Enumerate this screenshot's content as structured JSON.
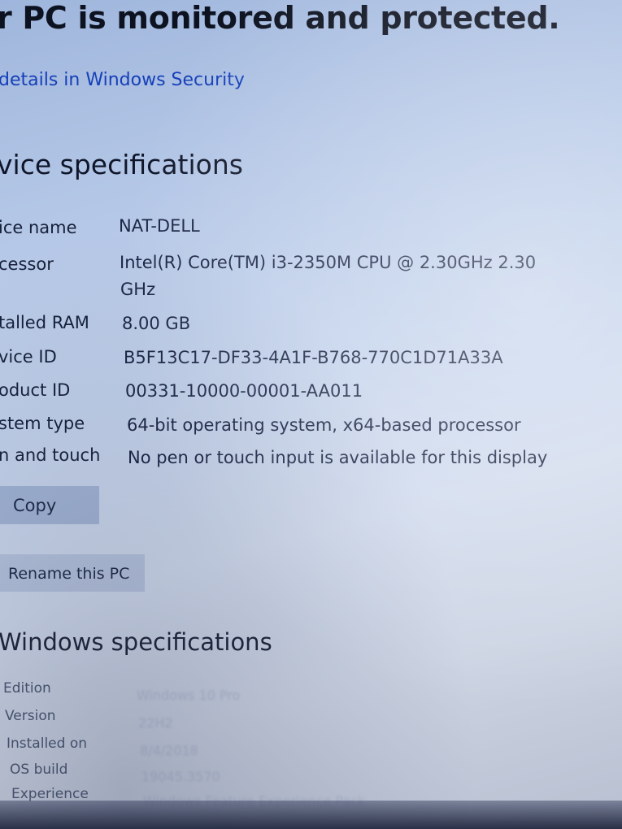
{
  "security": {
    "status_title": "r PC is monitored and protected.",
    "details_link": "details in Windows Security"
  },
  "device_specs": {
    "heading": "vice specifications",
    "rows": [
      {
        "label": "ice name",
        "value": "NAT-DELL"
      },
      {
        "label": "cessor",
        "value": "Intel(R) Core(TM) i3-2350M CPU @ 2.30GHz   2.30",
        "value_cont": "GHz"
      },
      {
        "label": "talled RAM",
        "value": "8.00 GB"
      },
      {
        "label": "vice ID",
        "value": "B5F13C17-DF33-4A1F-B768-770C1D71A33A"
      },
      {
        "label": "oduct ID",
        "value": "00331-10000-00001-AA011"
      },
      {
        "label": "stem type",
        "value": "64-bit operating system, x64-based processor"
      },
      {
        "label": "n and touch",
        "value": "No pen or touch input is available for this display"
      }
    ],
    "copy_label": "Copy",
    "rename_label": "Rename this PC"
  },
  "windows_specs": {
    "heading": "Windows specifications",
    "rows": [
      {
        "label": "Edition",
        "value": "Windows 10 Pro"
      },
      {
        "label": "Version",
        "value": "22H2"
      },
      {
        "label": "Installed on",
        "value": "8/4/2018"
      },
      {
        "label": "OS build",
        "value": "19045.3570"
      },
      {
        "label": "Experience",
        "value": "Windows Feature Experience Pack"
      }
    ]
  },
  "colors": {
    "link": "#1640b8",
    "button_bg": "#96aacd"
  }
}
